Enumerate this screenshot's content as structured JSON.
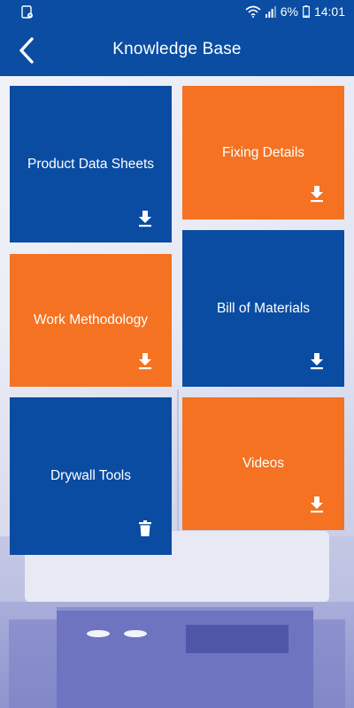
{
  "status_bar": {
    "battery": "6%",
    "time": "14:01",
    "icons": [
      "wifi-icon",
      "signal-icon",
      "battery-icon",
      "sim-status-icon"
    ]
  },
  "header": {
    "title": "Knowledge Base",
    "back_icon": "back-arrow-icon"
  },
  "tiles": [
    {
      "label": "Product Data Sheets",
      "color": "#0a4ca2",
      "action_icon": "download-icon"
    },
    {
      "label": "Fixing Details",
      "color": "#f47221",
      "action_icon": "download-icon"
    },
    {
      "label": "Work Methodology",
      "color": "#f47221",
      "action_icon": "download-icon"
    },
    {
      "label": "Bill of Materials",
      "color": "#0a4ca2",
      "action_icon": "download-icon"
    },
    {
      "label": "Drywall Tools",
      "color": "#0a4ca2",
      "action_icon": "trash-icon"
    },
    {
      "label": "Videos",
      "color": "#f47221",
      "action_icon": "download-icon"
    }
  ],
  "colors": {
    "primary_blue": "#0a4da2",
    "accent_orange": "#f47221"
  }
}
